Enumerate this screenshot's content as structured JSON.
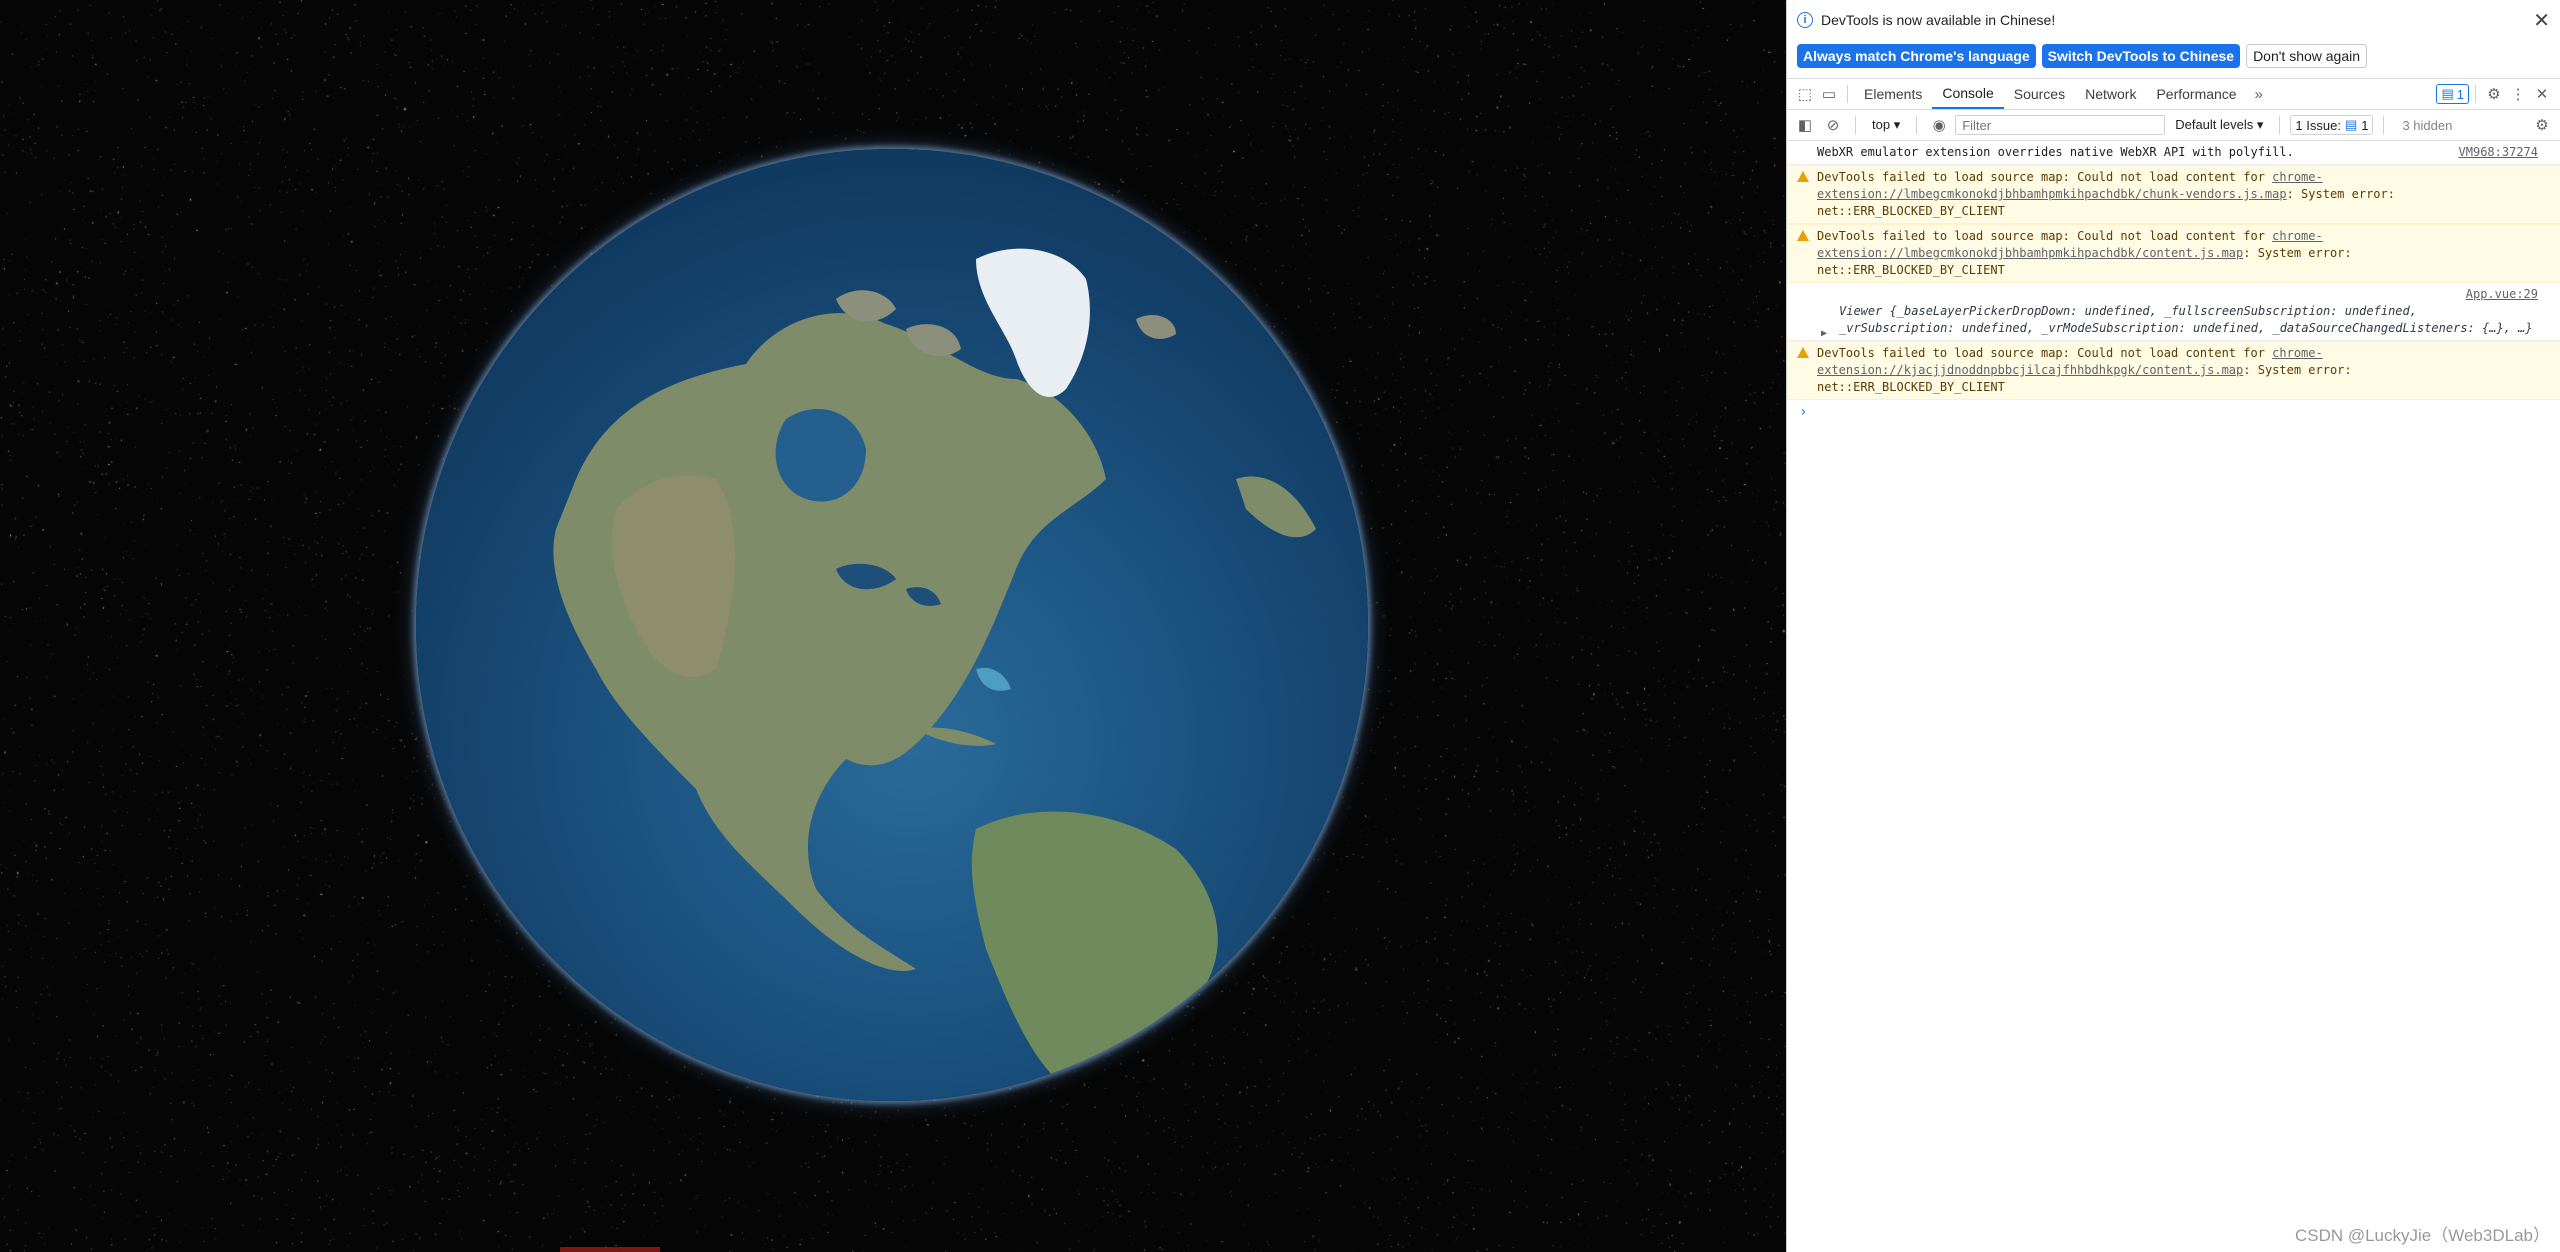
{
  "devtools": {
    "infobar_text": "DevTools is now available in Chinese!",
    "btn_match_language": "Always match Chrome's language",
    "btn_switch_chinese": "Switch DevTools to Chinese",
    "btn_dont_show": "Don't show again",
    "tabs": [
      "Elements",
      "Console",
      "Sources",
      "Network",
      "Performance"
    ],
    "active_tab": "Console",
    "message_badge_count": "1",
    "context": "top",
    "filter_placeholder": "Filter",
    "levels": "Default levels",
    "issues_label": "1 Issue:",
    "issues_count": "1",
    "hidden_label": "3 hidden"
  },
  "console": {
    "messages": [
      {
        "type": "info",
        "text": "WebXR emulator extension overrides native WebXR API with polyfill.",
        "source": "VM968:37274"
      },
      {
        "type": "warning",
        "text_before": "DevTools failed to load source map: Could not load content for ",
        "link": "chrome-extension://lmbegcmkonokdjbhbamhpmkihpachdbk/chunk-vendors.js.map",
        "text_after": ": System error: net::ERR_BLOCKED_BY_CLIENT"
      },
      {
        "type": "warning",
        "text_before": "DevTools failed to load source map: Could not load content for ",
        "link": "chrome-extension://lmbegcmkonokdjbhbamhpmkihpachdbk/content.js.map",
        "text_after": ": System error: net::ERR_BLOCKED_BY_CLIENT"
      },
      {
        "type": "log",
        "source": "App.vue:29",
        "object_preview": "Viewer {_baseLayerPickerDropDown: undefined, _fullscreenSubscription: undefined, _vrSubscription: undefined, _vrModeSubscription: undefined, _dataSourceChangedListeners: {…}, …}"
      },
      {
        "type": "warning",
        "text_before": "DevTools failed to load source map: Could not load content for ",
        "link": "chrome-extension://kjacjjdnoddnpbbcjilcajfhhbdhkpgk/content.js.map",
        "text_after": ": System error: net::ERR_BLOCKED_BY_CLIENT"
      }
    ],
    "prompt": "›"
  },
  "watermark": "CSDN @LuckyJie（Web3DLab）",
  "colors": {
    "accent": "#1a73e8",
    "warning_bg": "#fffbe5",
    "ocean": "#1c5482"
  },
  "icons": [
    "info-icon",
    "close-icon",
    "inspect-icon",
    "device-icon",
    "more-tabs-icon",
    "settings-icon",
    "kebab-icon",
    "sidebar-icon",
    "clear-icon",
    "eye-icon",
    "warning-icon",
    "message-icon",
    "expand-triangle-icon"
  ]
}
